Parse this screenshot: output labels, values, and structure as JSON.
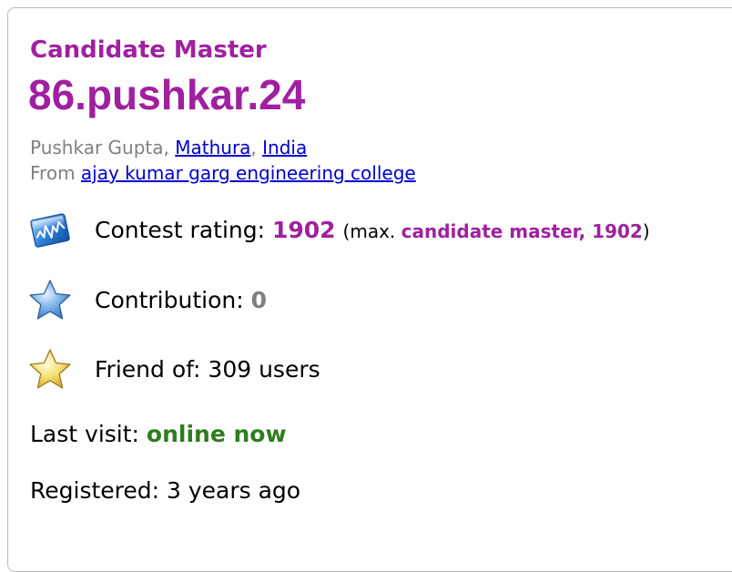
{
  "profile": {
    "rank": "Candidate Master",
    "handle": "86.pushkar.24",
    "rank_color": "#a020a0",
    "name": "Pushkar Gupta",
    "city": "Mathura",
    "country": "India",
    "from_label": "From",
    "organization": "ajay kumar garg engineering college"
  },
  "stats": {
    "rating_label": "Contest rating:",
    "rating_value": "1902",
    "max_prefix": "(max.",
    "max_rank": "candidate master, 1902",
    "max_suffix": ")",
    "rating_icon": "rating-chart-icon",
    "contribution_label": "Contribution:",
    "contribution_value": "0",
    "contribution_icon": "blue-star-icon",
    "friend_label": "Friend of:",
    "friend_value": "309 users",
    "friend_icon": "gold-star-icon",
    "last_visit_label": "Last visit:",
    "last_visit_value": "online now",
    "online_color": "#2e7d1f",
    "registered_label": "Registered:",
    "registered_value": "3 years ago"
  }
}
